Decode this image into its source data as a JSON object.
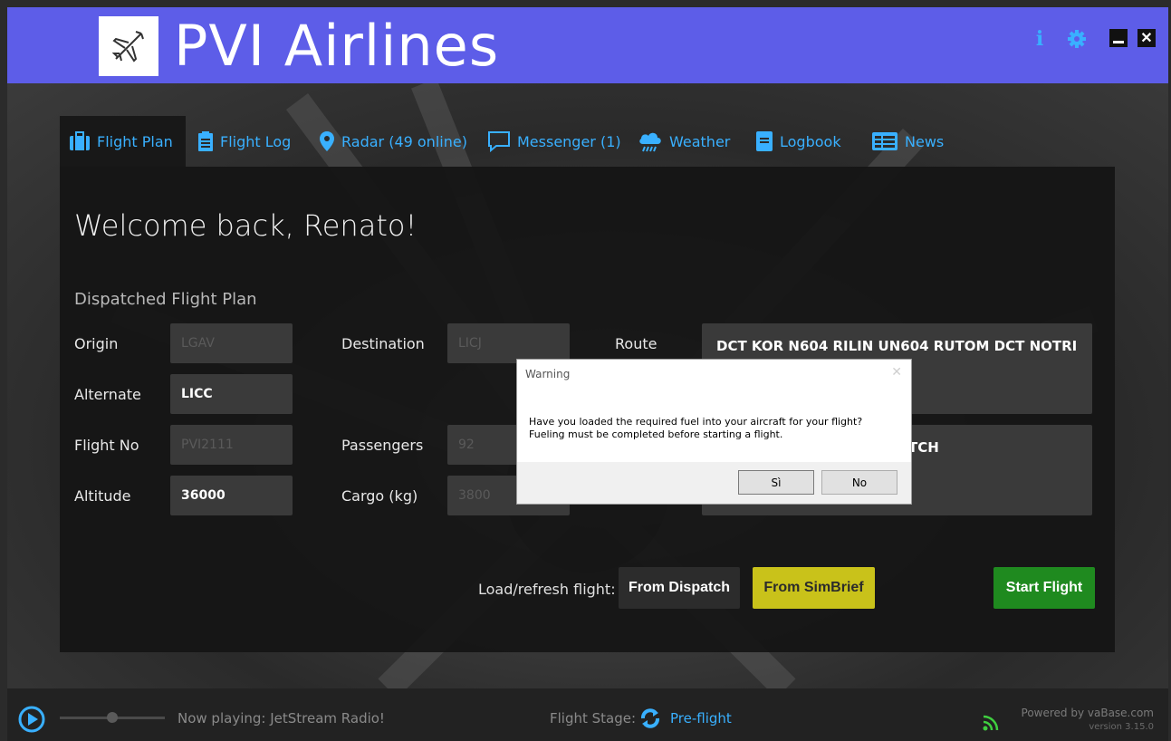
{
  "header": {
    "title": "PVI Airlines",
    "logo_icon": "airplane-icon",
    "info_icon": "info-icon",
    "settings_icon": "gear-icon",
    "minimize_icon": "minimize-icon",
    "close_icon": "close-icon",
    "bg_color": "#5d5de8"
  },
  "tabs": [
    {
      "label": "Flight Plan",
      "icon": "briefcase-icon",
      "active": true
    },
    {
      "label": "Flight Log",
      "icon": "clipboard-icon",
      "active": false
    },
    {
      "label": "Radar (49 online)",
      "icon": "map-pin-icon",
      "active": false
    },
    {
      "label": "Messenger (1)",
      "icon": "chat-icon",
      "active": false
    },
    {
      "label": "Weather",
      "icon": "rain-cloud-icon",
      "active": false
    },
    {
      "label": "Logbook",
      "icon": "book-icon",
      "active": false
    },
    {
      "label": "News",
      "icon": "newspaper-icon",
      "active": false
    }
  ],
  "main": {
    "welcome": "Welcome back, Renato!",
    "section_title": "Dispatched Flight Plan",
    "fields": {
      "origin": {
        "label": "Origin",
        "value": "LGAV"
      },
      "destination": {
        "label": "Destination",
        "value": "LICJ"
      },
      "route": {
        "label": "Route",
        "value": "DCT KOR N604 RILIN UN604 RUTOM DCT NOTRI"
      },
      "alternate": {
        "label": "Alternate",
        "value": "LICC"
      },
      "flight_no": {
        "label": "Flight No",
        "value": "PVI2111"
      },
      "passengers": {
        "label": "Passengers",
        "value": "92"
      },
      "remarks_partial": {
        "value": "TCH"
      },
      "altitude": {
        "label": "Altitude",
        "value": "36000"
      },
      "cargo": {
        "label": "Cargo (kg)",
        "value": "3800"
      }
    },
    "load_label": "Load/refresh flight:",
    "buttons": {
      "from_dispatch": "From Dispatch",
      "from_simbrief": "From SimBrief",
      "start_flight": "Start Flight"
    },
    "colors": {
      "simbrief": "#c9c21a",
      "start_flight": "#1f8a1f",
      "accent": "#39b0ff"
    }
  },
  "dialog": {
    "title": "Warning",
    "close_icon": "close-icon",
    "message_line1": "Have you loaded the required fuel into your aircraft for your flight?",
    "message_line2": "Fueling must be completed before starting a flight.",
    "yes_label": "Sì",
    "no_label": "No"
  },
  "footer": {
    "play_icon": "play-icon",
    "now_playing": "Now playing: JetStream Radio!",
    "stage_label": "Flight Stage:",
    "stage_icon": "refresh-icon",
    "stage_value": "Pre-flight",
    "rss_icon": "rss-icon",
    "powered_by": "Powered by vaBase.com",
    "version": "version 3.15.0"
  }
}
